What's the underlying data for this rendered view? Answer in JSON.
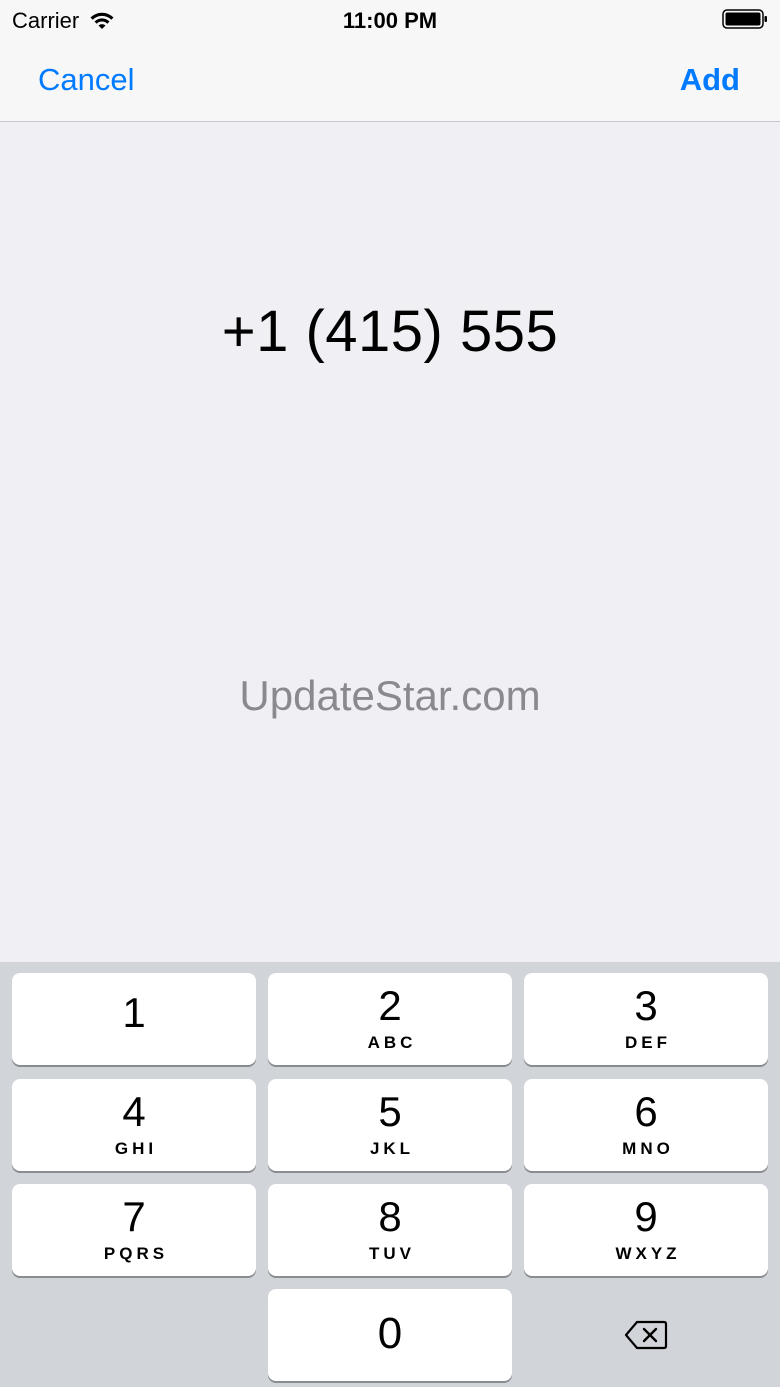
{
  "status_bar": {
    "carrier": "Carrier",
    "time": "11:00 PM"
  },
  "nav": {
    "cancel_label": "Cancel",
    "add_label": "Add"
  },
  "display": {
    "number": "+1 (415) 555",
    "watermark": "UpdateStar.com"
  },
  "keypad": {
    "keys": [
      {
        "digit": "1",
        "letters": ""
      },
      {
        "digit": "2",
        "letters": "ABC"
      },
      {
        "digit": "3",
        "letters": "DEF"
      },
      {
        "digit": "4",
        "letters": "GHI"
      },
      {
        "digit": "5",
        "letters": "JKL"
      },
      {
        "digit": "6",
        "letters": "MNO"
      },
      {
        "digit": "7",
        "letters": "PQRS"
      },
      {
        "digit": "8",
        "letters": "TUV"
      },
      {
        "digit": "9",
        "letters": "WXYZ"
      },
      {
        "digit": "0",
        "letters": ""
      }
    ],
    "delete_icon": "delete-backward-icon"
  },
  "colors": {
    "accent": "#007aff",
    "background": "#efeff4",
    "keypad_background": "#d1d4d9"
  }
}
